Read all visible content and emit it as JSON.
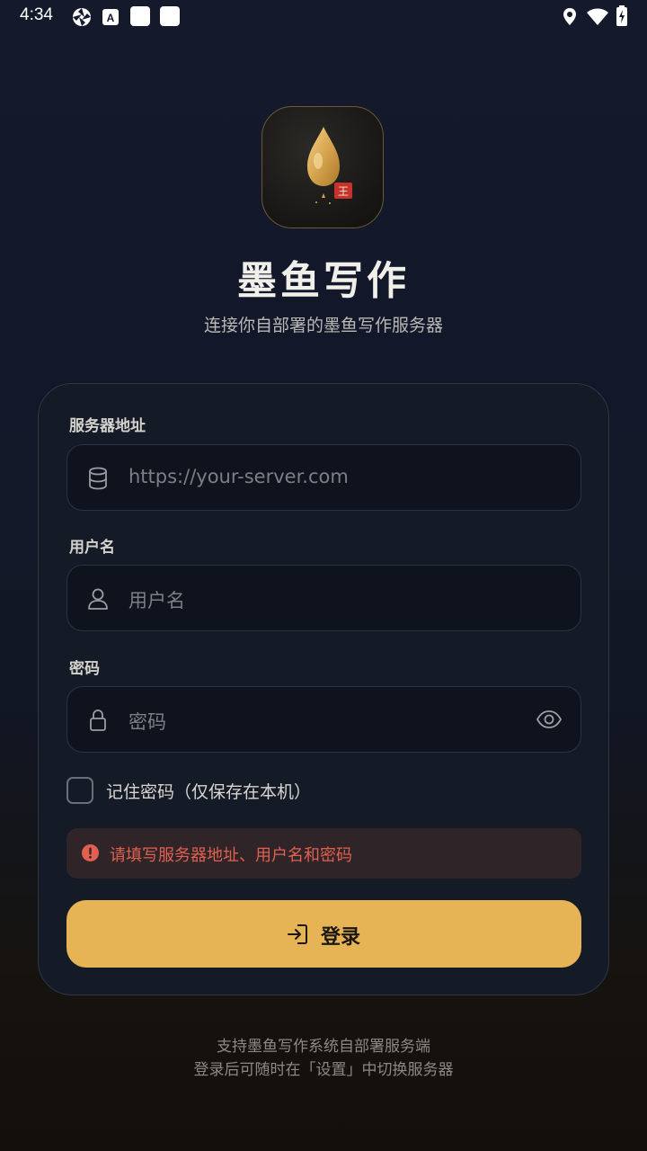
{
  "status_bar": {
    "time": "4:34",
    "left_icons": [
      "aperture-icon",
      "a-keyboard-icon",
      "square-icon",
      "square-icon"
    ],
    "right_icons": [
      "location-icon",
      "wifi-icon",
      "battery-charging-icon"
    ]
  },
  "app": {
    "logo_icon": "ink-drop-logo-icon",
    "title": "墨鱼写作",
    "subtitle": "连接你自部署的墨鱼写作服务器"
  },
  "form": {
    "server": {
      "label": "服务器地址",
      "placeholder": "https://your-server.com",
      "value": "",
      "icon": "database-icon"
    },
    "username": {
      "label": "用户名",
      "placeholder": "用户名",
      "value": "",
      "icon": "user-icon"
    },
    "password": {
      "label": "密码",
      "placeholder": "密码",
      "value": "",
      "icon": "lock-icon",
      "toggle_icon": "eye-icon"
    },
    "remember": {
      "label": "记住密码（仅保存在本机）",
      "checked": false
    },
    "error": {
      "icon": "alert-icon",
      "text": "请填写服务器地址、用户名和密码"
    },
    "submit": {
      "icon": "login-icon",
      "label": "登录"
    }
  },
  "footer": {
    "line1": "支持墨鱼写作系统自部署服务端",
    "line2": "登录后可随时在「设置」中切换服务器"
  },
  "colors": {
    "accent": "#e6b455",
    "error": "#e1604f",
    "card_bg": "#151a27"
  }
}
